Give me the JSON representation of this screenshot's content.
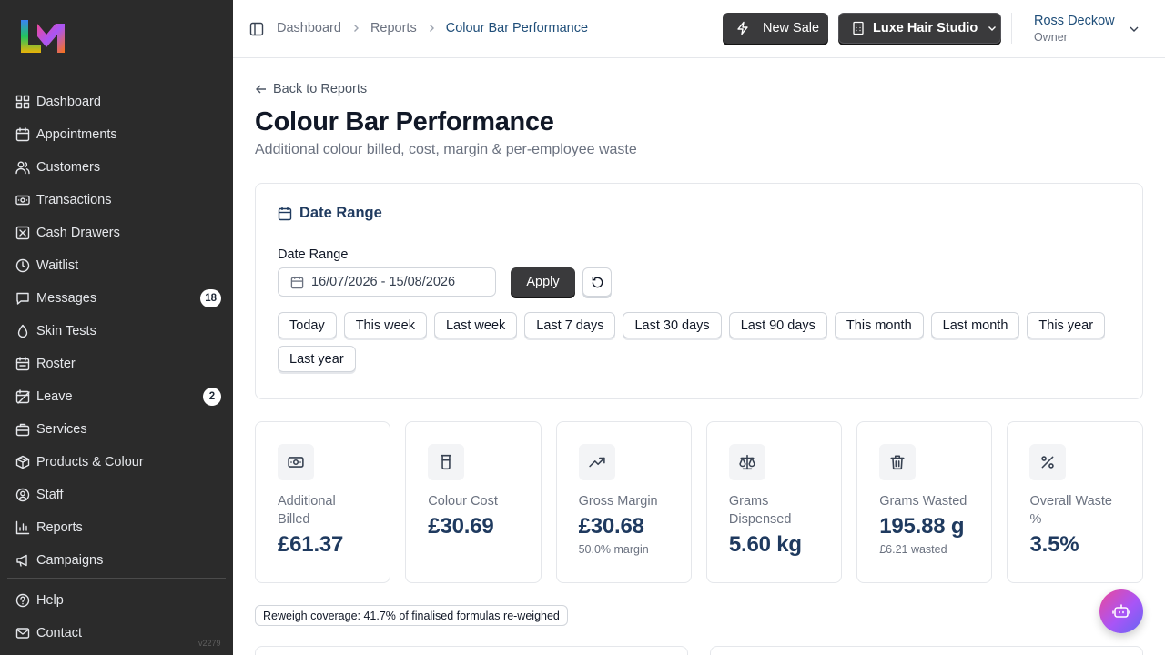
{
  "sidebar": {
    "brand": "LM",
    "nav": [
      {
        "label": "Dashboard",
        "icon": "dashboard-icon",
        "name": "dashboard"
      },
      {
        "label": "Appointments",
        "icon": "calendar-icon",
        "name": "appointments"
      },
      {
        "label": "Customers",
        "icon": "users-icon",
        "name": "customers"
      },
      {
        "label": "Transactions",
        "icon": "banknote-icon",
        "name": "transactions"
      },
      {
        "label": "Cash Drawers",
        "icon": "cash-drawer-icon",
        "name": "cash-drawers"
      },
      {
        "label": "Waitlist",
        "icon": "clock-icon",
        "name": "waitlist"
      },
      {
        "label": "Messages",
        "icon": "message-icon",
        "name": "messages",
        "badge": "18"
      },
      {
        "label": "Skin Tests",
        "icon": "droplet-icon",
        "name": "skin-tests"
      },
      {
        "label": "Roster",
        "icon": "roster-icon",
        "name": "roster"
      },
      {
        "label": "Leave",
        "icon": "calendar-off-icon",
        "name": "leave",
        "badge": "2"
      },
      {
        "label": "Services",
        "icon": "briefcase-icon",
        "name": "services"
      },
      {
        "label": "Products & Colour",
        "icon": "package-icon",
        "name": "products-colour"
      },
      {
        "label": "Staff",
        "icon": "user-circle-icon",
        "name": "staff"
      },
      {
        "label": "Reports",
        "icon": "bar-chart-icon",
        "name": "reports"
      },
      {
        "label": "Campaigns",
        "icon": "megaphone-icon",
        "name": "campaigns"
      }
    ],
    "bottom": [
      {
        "label": "Help",
        "icon": "help-icon",
        "name": "help"
      },
      {
        "label": "Contact",
        "icon": "mail-icon",
        "name": "contact"
      }
    ],
    "version": "v2279"
  },
  "topbar": {
    "breadcrumbs": [
      "Dashboard",
      "Reports",
      "Colour Bar Performance"
    ],
    "new_sale_label": "New Sale",
    "studio_label": "Luxe Hair Studio",
    "user_name": "Ross Deckow",
    "user_role": "Owner"
  },
  "page": {
    "back_label": "Back to Reports",
    "title": "Colour Bar Performance",
    "subtitle": "Additional colour billed, cost, margin & per-employee waste"
  },
  "date_card": {
    "title": "Date Range",
    "field_label": "Date Range",
    "value": "16/07/2026 - 15/08/2026",
    "apply_label": "Apply",
    "presets": [
      "Today",
      "This week",
      "Last week",
      "Last 7 days",
      "Last 30 days",
      "Last 90 days",
      "This month",
      "Last month",
      "This year",
      "Last year"
    ]
  },
  "stats": [
    {
      "label": "Additional Billed",
      "value": "£61.37",
      "note": "",
      "icon": "banknote-icon",
      "name": "additional-billed"
    },
    {
      "label": "Colour Cost",
      "value": "£30.69",
      "note": "",
      "icon": "beaker-icon",
      "name": "colour-cost"
    },
    {
      "label": "Gross Margin",
      "value": "£30.68",
      "note": "50.0% margin",
      "icon": "trending-up-icon",
      "name": "gross-margin"
    },
    {
      "label": "Grams Dispensed",
      "value": "5.60 kg",
      "note": "",
      "icon": "scale-icon",
      "name": "grams-dispensed"
    },
    {
      "label": "Grams Wasted",
      "value": "195.88 g",
      "note": "£6.21 wasted",
      "icon": "trash-icon",
      "name": "grams-wasted"
    },
    {
      "label": "Overall Waste %",
      "value": "3.5%",
      "note": "",
      "icon": "percent-icon",
      "name": "overall-waste"
    }
  ],
  "coverage_text": "Reweigh coverage: 41.7% of finalised formulas re-weighed",
  "colors": {
    "sidebar_bg": "#2b2b2b",
    "accent_navy": "#1f3a5f",
    "button_dark": "#3a3a3c"
  }
}
